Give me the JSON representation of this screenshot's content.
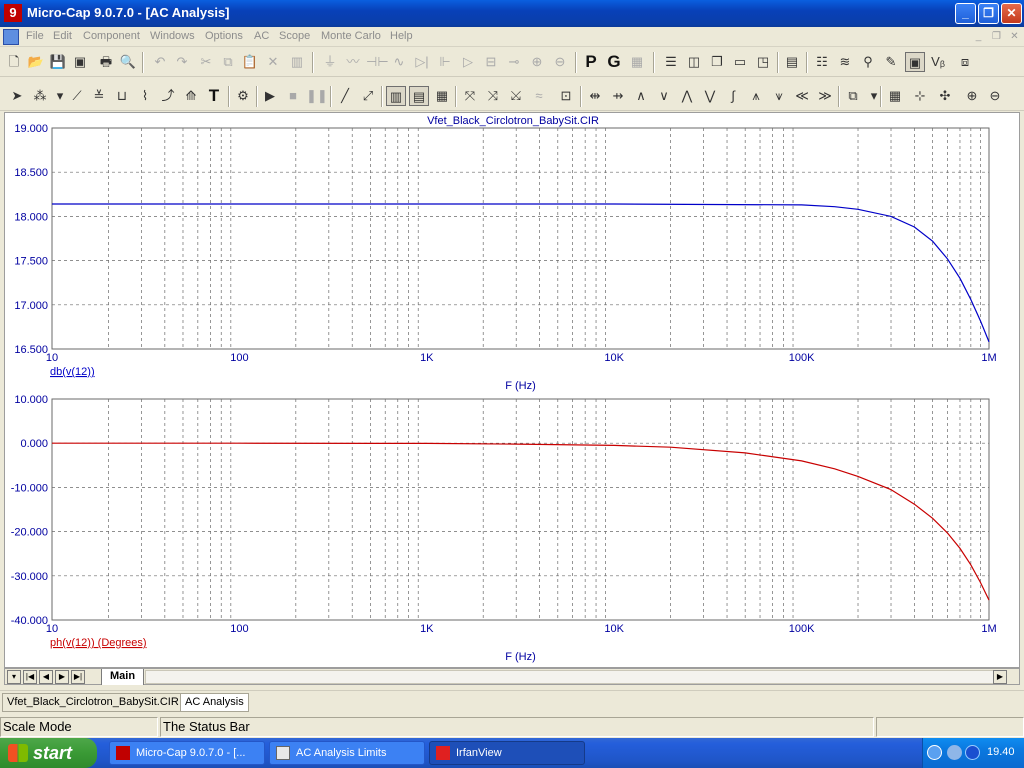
{
  "window": {
    "app_icon": "microcap-icon",
    "title": "Micro-Cap 9.0.7.0 - [AC Analysis]",
    "minimize": "_",
    "maximize": "❐",
    "close": "✕"
  },
  "menu": {
    "items": [
      "File",
      "Edit",
      "Component",
      "Windows",
      "Options",
      "AC",
      "Scope",
      "Monte Carlo",
      "Help"
    ],
    "mdi_min": "_",
    "mdi_restore": "❐",
    "mdi_close": "✕"
  },
  "toolbar1": {
    "p_label": "P",
    "g_label": "G"
  },
  "plot": {
    "title": "Vfet_Black_Circlotron_BabySit.CIR"
  },
  "chart_data": [
    {
      "type": "line",
      "title": "Vfet_Black_Circlotron_BabySit.CIR",
      "xlabel": "F (Hz)",
      "ylabel": "db(v(12))",
      "xscale": "log",
      "xlim": [
        10,
        1000000
      ],
      "ylim": [
        16.5,
        19.0
      ],
      "x_tick_labels": [
        "10",
        "100",
        "1K",
        "10K",
        "100K",
        "1M"
      ],
      "y_tick_labels": [
        "19.000",
        "18.500",
        "18.000",
        "17.500",
        "17.000",
        "16.500"
      ],
      "grid": true,
      "color": "#0000c8",
      "series": [
        {
          "name": "db(v(12))",
          "x": [
            10,
            100,
            1000,
            10000,
            100000,
            150000,
            200000,
            300000,
            400000,
            500000,
            600000,
            700000,
            800000,
            900000,
            1000000
          ],
          "y": [
            18.14,
            18.14,
            18.14,
            18.14,
            18.13,
            18.11,
            18.08,
            18.0,
            17.88,
            17.72,
            17.52,
            17.3,
            17.06,
            16.82,
            16.58
          ]
        }
      ]
    },
    {
      "type": "line",
      "xlabel": "F (Hz)",
      "ylabel": "ph(v(12)) (Degrees)",
      "xscale": "log",
      "xlim": [
        10,
        1000000
      ],
      "ylim": [
        -40,
        10
      ],
      "x_tick_labels": [
        "10",
        "100",
        "1K",
        "10K",
        "100K",
        "1M"
      ],
      "y_tick_labels": [
        "10.000",
        "0.000",
        "-10.000",
        "-20.000",
        "-30.000",
        "-40.000"
      ],
      "grid": true,
      "color": "#c80000",
      "series": [
        {
          "name": "ph(v(12)) (Degrees)",
          "x": [
            10,
            100,
            1000,
            3000,
            10000,
            20000,
            50000,
            100000,
            150000,
            200000,
            300000,
            400000,
            500000,
            600000,
            700000,
            800000,
            900000,
            1000000
          ],
          "y": [
            0.0,
            0.0,
            -0.05,
            -0.2,
            -0.5,
            -0.9,
            -2.2,
            -4.0,
            -5.8,
            -7.5,
            -10.5,
            -13.8,
            -17.0,
            -20.3,
            -23.8,
            -27.5,
            -31.5,
            -35.5
          ]
        }
      ]
    }
  ],
  "sheet": {
    "tab": "Main",
    "nav": [
      "▾",
      "|◀",
      "◀",
      "▶",
      "▶|"
    ]
  },
  "doc_tabs": [
    "Vfet_Black_Circlotron_BabySit.CIR",
    "AC Analysis"
  ],
  "status": {
    "mode": "Scale Mode",
    "message": "The Status Bar"
  },
  "taskbar": {
    "start": "start",
    "tasks": [
      "Micro-Cap 9.0.7.0 - [...",
      "AC Analysis Limits",
      "IrfanView"
    ],
    "clock": "19.40"
  }
}
